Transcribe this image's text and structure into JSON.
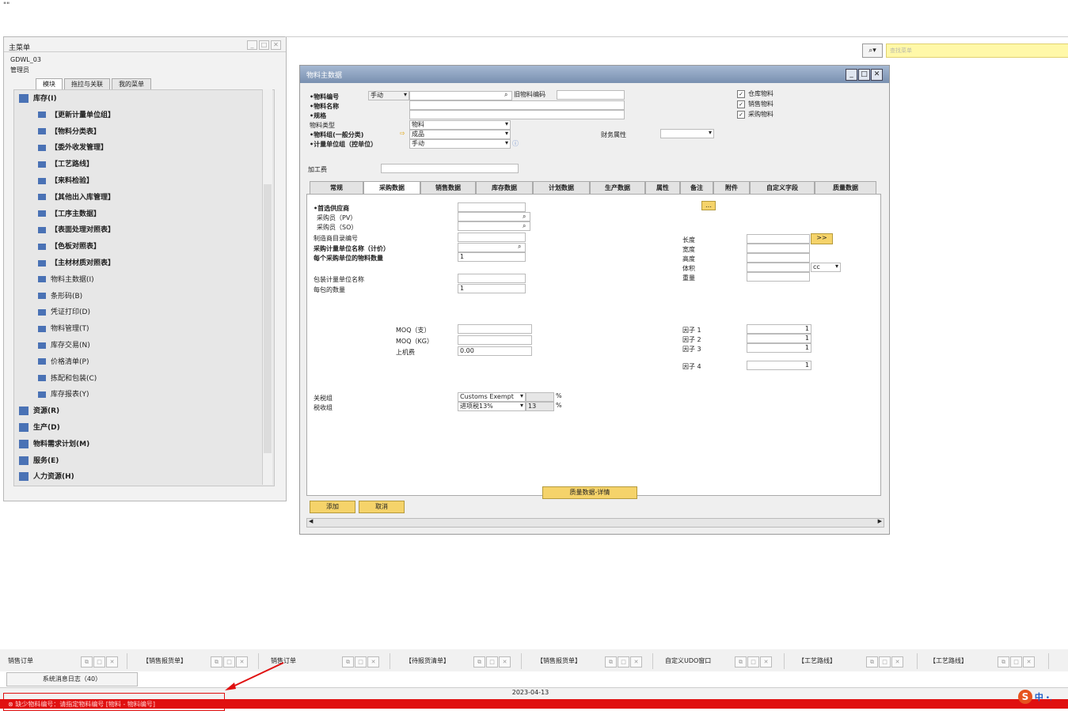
{
  "corner_mark": "\"\"",
  "main_menu": {
    "title": "主菜单",
    "db": "GDWL_03",
    "user": "管理员",
    "tabs": [
      "模块",
      "拖拉与关联",
      "我的菜单"
    ],
    "tree": [
      {
        "label": "库存(I)",
        "level": 0,
        "bold": true
      },
      {
        "label": "【更新计量单位组】",
        "level": 1,
        "bold": true
      },
      {
        "label": "【物料分类表】",
        "level": 1,
        "bold": true
      },
      {
        "label": "【委外收发管理】",
        "level": 1,
        "bold": true
      },
      {
        "label": "【工艺路线】",
        "level": 1,
        "bold": true
      },
      {
        "label": "【来料检验】",
        "level": 1,
        "bold": true
      },
      {
        "label": "【其他出入库管理】",
        "level": 1,
        "bold": true
      },
      {
        "label": "【工序主数据】",
        "level": 1,
        "bold": true
      },
      {
        "label": "【表面处理对照表】",
        "level": 1,
        "bold": true
      },
      {
        "label": "【色板对照表】",
        "level": 1,
        "bold": true
      },
      {
        "label": "【主材材质对照表】",
        "level": 1,
        "bold": true
      },
      {
        "label": "物料主数据(I)",
        "level": 1,
        "bold": false
      },
      {
        "label": "条形码(B)",
        "level": 1,
        "bold": false
      },
      {
        "label": "凭证打印(D)",
        "level": 1,
        "bold": false
      },
      {
        "label": "物料管理(T)",
        "level": 1,
        "bold": false
      },
      {
        "label": "库存交易(N)",
        "level": 1,
        "bold": false
      },
      {
        "label": "价格清单(P)",
        "level": 1,
        "bold": false
      },
      {
        "label": "拣配和包装(C)",
        "level": 1,
        "bold": false
      },
      {
        "label": "库存报表(Y)",
        "level": 1,
        "bold": false
      },
      {
        "label": "资源(R)",
        "level": 0,
        "bold": true
      },
      {
        "label": "生产(D)",
        "level": 0,
        "bold": true
      },
      {
        "label": "物料需求计划(M)",
        "level": 0,
        "bold": true
      },
      {
        "label": "服务(E)",
        "level": 0,
        "bold": true
      },
      {
        "label": "人力资源(H)",
        "level": 0,
        "bold": true
      }
    ]
  },
  "search": {
    "placeholder": "查找菜单"
  },
  "item_master": {
    "title": "物料主数据",
    "header": {
      "item_no_label": "•物料编号",
      "item_no_mode": "手动",
      "old_item_label": "旧物料编码",
      "item_name_label": "•物料名称",
      "spec_label": "•规格",
      "item_type_label": "物料类型",
      "item_type_value": "物料",
      "item_group_label": "•物料组(一般分类)",
      "item_group_value": "成品",
      "uom_group_label": "•计量单位组（控单位）",
      "uom_group_value": "手动",
      "tax_attr_label": "财务属性",
      "processing_label": "加工费",
      "checks": [
        "仓库物料",
        "销售物料",
        "采购物料"
      ]
    },
    "tabs": [
      "常规",
      "采购数据",
      "销售数据",
      "库存数据",
      "计划数据",
      "生产数据",
      "属性",
      "备注",
      "附件",
      "自定义字段",
      "质量数据"
    ],
    "active_tab": "采购数据",
    "purchasing": {
      "preferred_vendor": "•首选供应商",
      "buyer_pv": "采购员（PV）",
      "buyer_so": "采购员（SO）",
      "mfr_catalog": "制造商目录编号",
      "purch_uom_name": "采购计量单位名称（计价）",
      "items_per_purch_unit": "每个采购单位的物料数量",
      "items_per_purch_unit_value": "1",
      "pkg_uom_name": "包装计量单位名称",
      "qty_per_pkg": "每包的数量",
      "qty_per_pkg_value": "1",
      "moq_pc": "MOQ（支）",
      "moq_kg": "MOQ（KG）",
      "machine_fee": "上机费",
      "machine_fee_value": "0.00",
      "length": "长度",
      "width": "宽度",
      "height": "高度",
      "volume": "体积",
      "volume_unit": "cc",
      "weight": "重量",
      "factors": [
        {
          "label": "因子 1",
          "value": "1"
        },
        {
          "label": "因子 2",
          "value": "1"
        },
        {
          "label": "因子 3",
          "value": "1"
        },
        {
          "label": "因子 4",
          "value": "1"
        }
      ],
      "customs_group": "关税组",
      "customs_value": "Customs Exempt",
      "tax_group": "税收组",
      "tax_value": "进项税13%",
      "tax_rate": "13",
      "percent": "%",
      "more_btn": ">>"
    },
    "quality_btn": "质量数据-详情",
    "add_btn": "添加",
    "cancel_btn": "取消"
  },
  "taskbar": [
    "销售订单",
    "【销售报货单】",
    "销售订单",
    "【待报货清单】",
    "【销售报货单】",
    "自定义UDO窗口",
    "【工艺路线】",
    "【工艺路线】"
  ],
  "message_log": "系统消息日志（40）",
  "status_date": "2023-04-13",
  "error_text": "缺少物料编号：请指定物料编号 [物料 - 物料编号]",
  "ime": {
    "logo": "S",
    "lang": "中",
    "dot": "•,"
  }
}
